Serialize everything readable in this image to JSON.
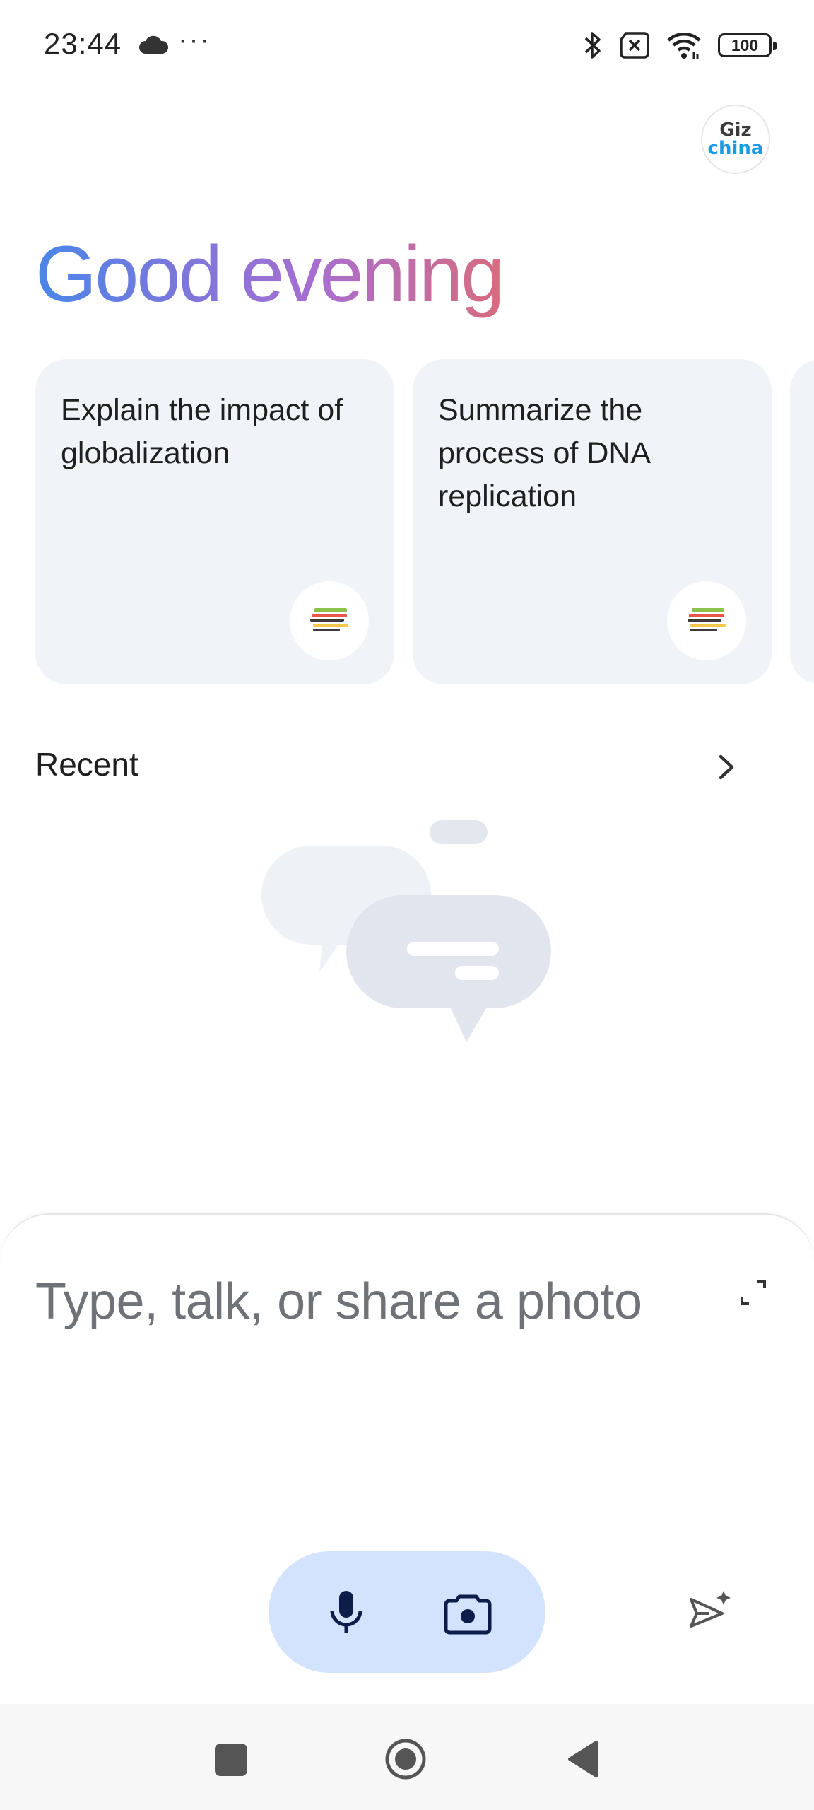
{
  "status_bar": {
    "time": "23:44",
    "overflow": "···",
    "battery": "100",
    "icons": [
      "cloud-icon",
      "bluetooth-icon",
      "no-sim-icon",
      "wifi-icon",
      "battery-icon"
    ]
  },
  "avatar": {
    "line1": "Giz",
    "line2": "china"
  },
  "greeting": "Good evening",
  "suggestions": [
    {
      "text": "Explain the impact of globalization",
      "icon": "books-icon"
    },
    {
      "text": "Summarize the process of DNA replication",
      "icon": "books-icon"
    }
  ],
  "recent": {
    "title": "Recent",
    "icon": "chevron-right-icon"
  },
  "input": {
    "placeholder": "Type, talk, or share a photo",
    "icons": [
      "expand-icon",
      "mic-icon",
      "camera-icon",
      "send-icon"
    ]
  },
  "navbar": {
    "icons": [
      "recents-square-icon",
      "home-circle-icon",
      "back-triangle-icon"
    ]
  },
  "colors": {
    "card_bg": "#f0f4f9",
    "pill_bg": "#d3e3fd",
    "greeting_gradient": [
      "#4a86e8",
      "#a76ed0",
      "#d86b7e"
    ],
    "icon_dark": "#0b1d48"
  }
}
